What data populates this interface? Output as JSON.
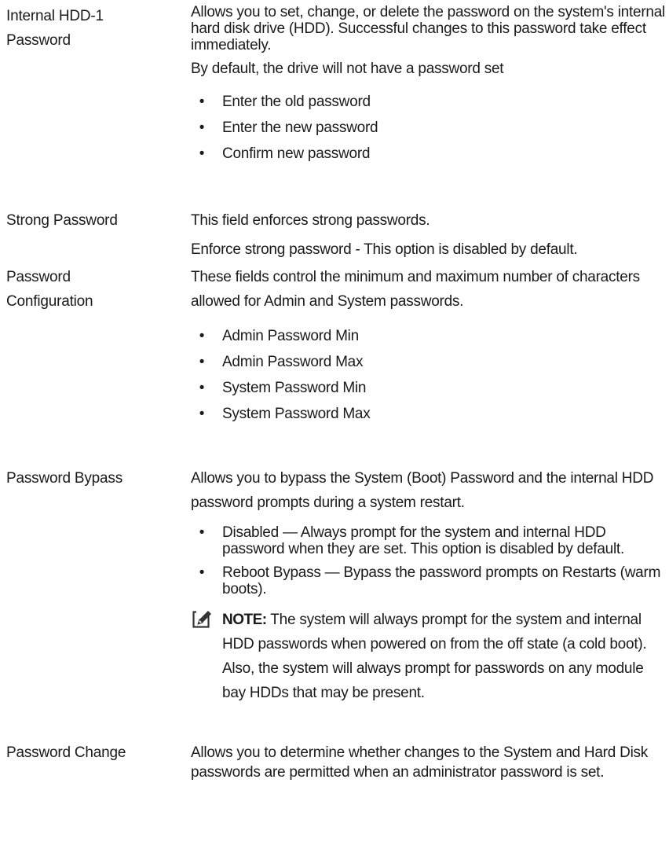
{
  "rows": [
    {
      "label": "Internal HDD-1 Password",
      "paragraphs": [
        "Allows you to set, change, or delete the password on the system's internal hard disk drive (HDD). Successful changes to this password take effect immediately.",
        "By default, the drive will not have a password set"
      ],
      "bullets": [
        "Enter the old password",
        "Enter the new password",
        "Confirm new password"
      ]
    },
    {
      "label": "Strong Password",
      "paragraphs": [
        "This field enforces strong passwords.",
        "Enforce strong password - This option is disabled by default."
      ]
    },
    {
      "label": "Password Configuration",
      "paragraphs": [
        "These fields control the minimum and maximum number of characters allowed for Admin and System passwords."
      ],
      "bullets": [
        "Admin Password Min",
        "Admin Password Max",
        "System Password Min",
        "System Password Max"
      ]
    },
    {
      "label": "Password Bypass",
      "paragraphs": [
        "Allows you to bypass the System (Boot) Password and the internal HDD password prompts during a system restart."
      ],
      "bullets": [
        "Disabled — Always prompt for the system and internal HDD password when they are set. This option is disabled by default.",
        "Reboot Bypass — Bypass the password prompts on Restarts (warm boots)."
      ],
      "note": {
        "icon": "pencil-note-icon",
        "heading": "NOTE:",
        "text": "The system will always prompt for the system and internal HDD passwords when powered on from the off state (a cold boot). Also, the system will always prompt for passwords on any module bay HDDs that may be present."
      }
    },
    {
      "label": "Password Change",
      "paragraphs": [
        "Allows you to determine whether changes to the System and Hard Disk passwords are permitted when an administrator password is set."
      ]
    }
  ],
  "bullet_glyph": "•"
}
